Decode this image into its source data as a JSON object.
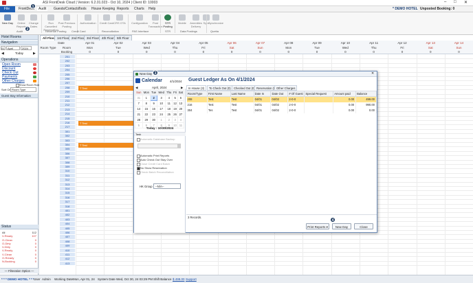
{
  "app": {
    "title": "ASI FrontDesk Cloud | Version: 6.2.01.023 - Oct 10, 2024 | Client ID: 10003",
    "hotel_name": "DEMO HOTEL",
    "unposted": "Unposted Booking: 0"
  },
  "menu": [
    "File",
    "FrontDesk",
    "Audit",
    "Guests/Contacts",
    "Tools",
    "House Keeping",
    "Reports",
    "Charts",
    "Help"
  ],
  "ribbon": {
    "buttons": [
      "New Day",
      "Online Reports",
      "Change Dates",
      "Run Cancelled Reservation",
      "Post Previous Posting",
      "Authorization",
      "Credit Card",
      "CRS OTA",
      "Configuration",
      "Post Transaction",
      "STR Posting",
      "Mobile",
      "Amenities Delivery",
      "Sync",
      "Synchronize"
    ],
    "groups": [
      "Audit",
      "Revenue Posting",
      "Credit Card",
      "Reconciliation",
      "PAS Interface",
      "STR",
      "Data Postings",
      "Quetta"
    ]
  },
  "left": {
    "hotel_header": "Hotel Rooms",
    "nav_header": "Navigation",
    "nav_day": "01",
    "nav_month": "April",
    "nav_year": "2024",
    "today_label": "Today",
    "ops_header": "Operations",
    "ops": [
      "Open Room",
      "Discount",
      "Check Out",
      "Payments",
      "Other Charges"
    ],
    "show_room_rate": "Show Room Rate",
    "sort_on_label": "Sort On",
    "sort_on_value": "Room Type",
    "guest_stay_info": "Guest Stay Information",
    "status_header": "Status",
    "status_rows": [
      [
        "All",
        "112"
      ],
      [
        "V-Ready",
        "107"
      ],
      [
        "O-Clean",
        "0"
      ],
      [
        "O-Dirty",
        "0"
      ],
      [
        "V-Dirty",
        "0"
      ],
      [
        "V-Ready",
        "0"
      ],
      [
        "V-Clean",
        "0"
      ],
      [
        "O-Rready",
        "0"
      ],
      [
        "N-Booking",
        "0"
      ]
    ],
    "filter_option": "Filteration Option"
  },
  "grid": {
    "tabs": [
      "All Floors",
      "1st Floor",
      "2nd Floor",
      "3rd Floor",
      "4th Floor",
      "5th Floor"
    ],
    "date_label": "Date",
    "room_type_label": "Room Type",
    "room_label": "Room",
    "booking_label": "Booking",
    "dates": [
      [
        "Apr 01",
        "Mon"
      ],
      [
        "Apr 02",
        "Tue"
      ],
      [
        "Apr 03",
        "Wed"
      ],
      [
        "Apr 04",
        "Thu"
      ],
      [
        "Apr 05",
        "Fri"
      ],
      [
        "Apr 06",
        "Sat"
      ],
      [
        "Apr 07",
        "Sun"
      ],
      [
        "Apr 08",
        "Mon"
      ],
      [
        "Apr 09",
        "Tue"
      ],
      [
        "Apr 10",
        "Wed"
      ],
      [
        "Apr 11",
        "Thu"
      ],
      [
        "Apr 12",
        "Fri"
      ],
      [
        "Apr 13",
        "Sat"
      ],
      [
        "Apr 14",
        "Sun"
      ]
    ],
    "counts": [
      "0",
      "0",
      "0",
      "0",
      "0",
      "0",
      "0",
      "0",
      "0",
      "0",
      "0",
      "0",
      "0",
      "0"
    ],
    "rooms": [
      "201",
      "202",
      "203",
      "204",
      "205",
      "206",
      "207",
      "208",
      "209",
      "210",
      "211",
      "212",
      "213",
      "214",
      "215",
      "216",
      "217",
      "301",
      "302",
      "303",
      "304",
      "305",
      "306",
      "307",
      "308",
      "309",
      "310",
      "311",
      "312",
      "313",
      "314",
      "315",
      "316",
      "317",
      "318",
      "401",
      "402",
      "403",
      "404",
      "405",
      "406",
      "407",
      "408",
      "409",
      "410",
      "411",
      "412",
      "413"
    ],
    "bookings": [
      {
        "room": "208",
        "label": "T Test"
      },
      {
        "room": "216",
        "label": "T Test"
      },
      {
        "room": "304",
        "label": "T Test"
      }
    ]
  },
  "dialog": {
    "title": "New Day",
    "calendar": {
      "title": "Calendar",
      "date": "4/1/2024",
      "month": "April, 2024",
      "weekdays": [
        "Sun",
        "Mon",
        "Tue",
        "Wed",
        "Thu",
        "Fri",
        "Sat"
      ],
      "weeks": [
        [
          "31",
          "1",
          "2",
          "3",
          "4",
          "5",
          "6"
        ],
        [
          "7",
          "8",
          "9",
          "10",
          "11",
          "12",
          "13"
        ],
        [
          "14",
          "15",
          "16",
          "17",
          "18",
          "19",
          "20"
        ],
        [
          "21",
          "22",
          "23",
          "24",
          "25",
          "26",
          "27"
        ],
        [
          "28",
          "29",
          "30",
          "1",
          "2",
          "3",
          "4"
        ],
        [
          "5",
          "6",
          "7",
          "8",
          "9",
          "10",
          "11"
        ]
      ],
      "today": "Today : 10/30/2024"
    },
    "task_label": "Task",
    "tasks": [
      "Automatic Database Backup",
      "Automatic Print Reports",
      "Auto Check Out Stay Over",
      "Close Credit Card Batch",
      "No Show Reservation",
      "Check Batch Reconciliation"
    ],
    "hk_group_label": "HK Group",
    "hk_group_value": "--N/A--",
    "ledger_title": "Guest Ledger As On 4/1/2024",
    "ledger_tabs": [
      "In House (3)",
      "To Check Out (0)",
      "Checked Out (0)",
      "Reservation (0)",
      "Other Charges"
    ],
    "columns": [
      "Room/Type",
      "First Name",
      "Last Name",
      "Date In",
      "Date Out",
      "# Of Guest",
      "Special Request",
      "Amount paid",
      "Balance"
    ],
    "rows": [
      [
        "208",
        "Test",
        "Test",
        "04/01",
        "04/02",
        "2-0-0",
        "",
        "0.00",
        "499.00"
      ],
      [
        "216",
        "Test",
        "Test",
        "04/01",
        "04/02",
        "2-0-0",
        "",
        "0.00",
        "990.00"
      ],
      [
        "304",
        "Tes",
        "Test",
        "04/01",
        "04/02",
        "2-0-0",
        "",
        "0.00",
        "0.00"
      ]
    ],
    "records": "3 Records.",
    "buttons": {
      "print_reports": "Print Reports",
      "new_day": "New Day",
      "close": "Close"
    }
  },
  "badges": [
    "1",
    "2",
    "3",
    "4"
  ],
  "statusbar": {
    "hotel": "DEMO HOTEL",
    "user_label": "User",
    "user": "Admin",
    "working_date_label": "Working Date",
    "working_date": "Mon, Apr 01, 24",
    "system_date_label": "System Date",
    "system_date": "Wed, Oct 30, 24 03:29 PM",
    "shift_label": "Shift Balance",
    "shift_balance": "$ 499.00",
    "support": "Support"
  }
}
